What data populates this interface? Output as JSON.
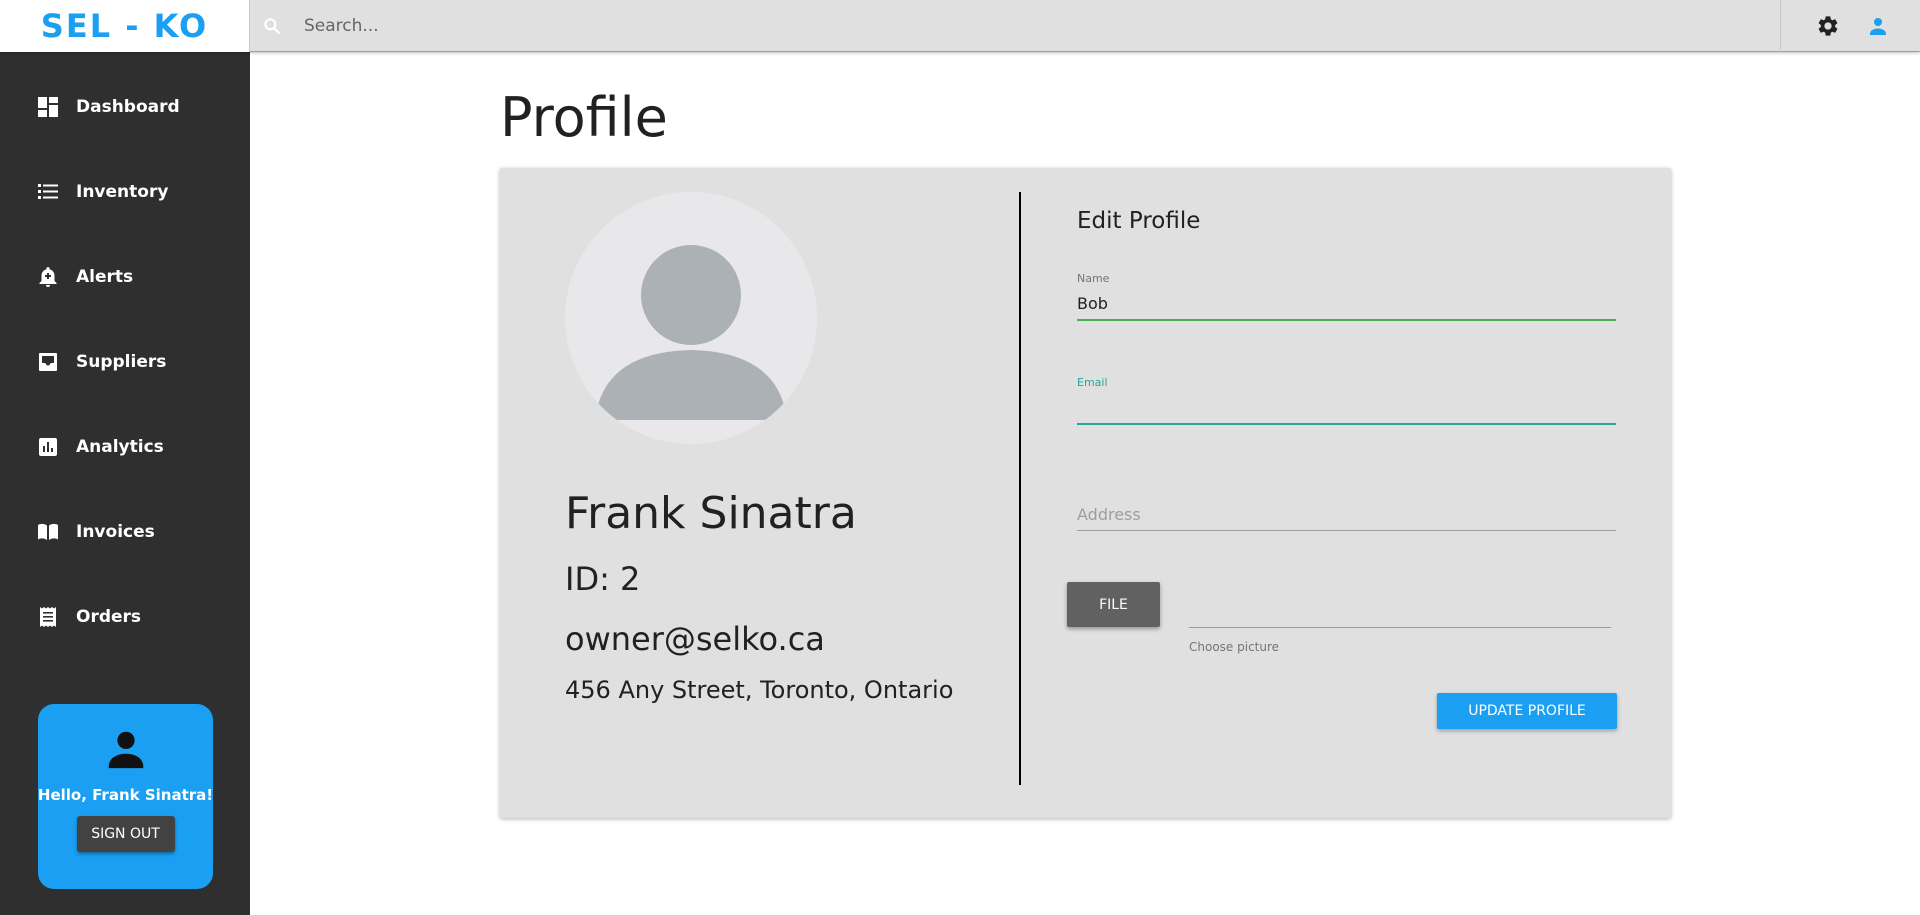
{
  "app": {
    "logo": "SEL - KO"
  },
  "search": {
    "placeholder": "Search...",
    "icon": "search-icon"
  },
  "header": {
    "icons": [
      "gear-icon",
      "user-icon"
    ]
  },
  "sidebar": {
    "items": [
      {
        "label": "Dashboard",
        "icon": "dashboard-icon"
      },
      {
        "label": "Inventory",
        "icon": "list-icon"
      },
      {
        "label": "Alerts",
        "icon": "bell-icon"
      },
      {
        "label": "Suppliers",
        "icon": "inbox-icon"
      },
      {
        "label": "Analytics",
        "icon": "chart-icon"
      },
      {
        "label": "Invoices",
        "icon": "book-icon"
      },
      {
        "label": "Orders",
        "icon": "receipt-icon"
      }
    ],
    "greeting": "Hello, Frank Sinatra!",
    "signout_label": "SIGN OUT"
  },
  "main": {
    "title": "Profile"
  },
  "profile": {
    "name": "Frank Sinatra",
    "id": "ID: 2",
    "email": "owner@selko.ca",
    "address": "456 Any Street, Toronto, Ontario"
  },
  "edit": {
    "title": "Edit Profile",
    "name_label": "Name",
    "name_value": "Bob",
    "email_label": "Email",
    "email_value": "",
    "address_placeholder": "Address",
    "file_label": "FILE",
    "file_hint": "Choose picture",
    "update_label": "UPDATE PROFILE"
  },
  "colors": {
    "brand": "#1a9ff2",
    "sidebar": "#2f2f2f",
    "card": "#e0e0e0",
    "valid": "#4caf50",
    "focus": "#26a69a"
  }
}
